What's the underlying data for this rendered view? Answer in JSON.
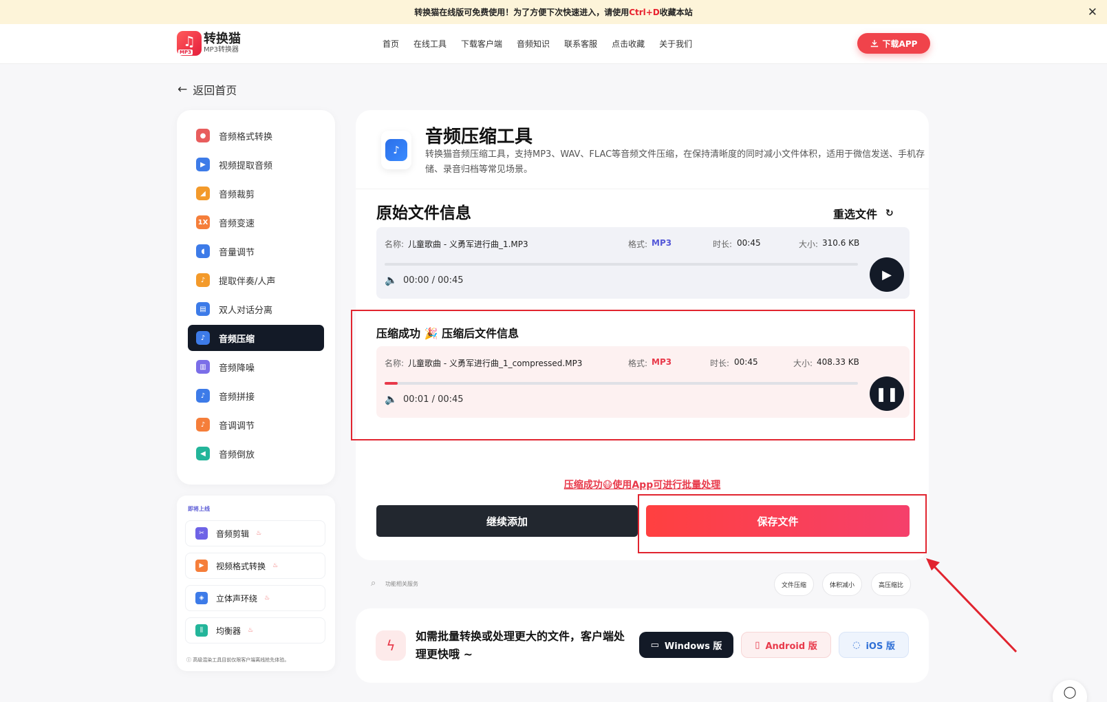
{
  "announcement": {
    "prefix": "转换猫在线版可免费使用！为了方便下次快速进入，请使用",
    "hotkey": "Ctrl+D",
    "suffix": "收藏本站",
    "close": "✕"
  },
  "header": {
    "logo_title": "转换猫",
    "logo_sub": "MP3转换器",
    "logo_badge": "MP3",
    "nav": [
      "首页",
      "在线工具",
      "下载客户端",
      "音频知识",
      "联系客服",
      "点击收藏",
      "关于我们"
    ],
    "download_app": "下载APP"
  },
  "back_label": "返回首页",
  "sidebar": {
    "items": [
      {
        "label": "音频格式转换",
        "icon": "format-convert-icon",
        "color": "#e85d5d"
      },
      {
        "label": "视频提取音频",
        "icon": "video-extract-icon",
        "color": "#3d7be8"
      },
      {
        "label": "音频裁剪",
        "icon": "audio-cut-icon",
        "color": "#f39a2b"
      },
      {
        "label": "音频变速",
        "icon": "speed-icon",
        "color": "#f57e3a"
      },
      {
        "label": "音量调节",
        "icon": "volume-adjust-icon",
        "color": "#3d7be8"
      },
      {
        "label": "提取伴奏/人声",
        "icon": "vocal-extract-icon",
        "color": "#f39a2b"
      },
      {
        "label": "双人对话分离",
        "icon": "dialog-split-icon",
        "color": "#3d7be8"
      },
      {
        "label": "音频压缩",
        "icon": "audio-compress-icon",
        "color": "#3d7be8"
      },
      {
        "label": "音频降噪",
        "icon": "denoise-icon",
        "color": "#7b6ee8"
      },
      {
        "label": "音频拼接",
        "icon": "audio-join-icon",
        "color": "#3d7be8"
      },
      {
        "label": "音调调节",
        "icon": "pitch-icon",
        "color": "#f57e3a"
      },
      {
        "label": "音频倒放",
        "icon": "reverse-icon",
        "color": "#23b59a"
      }
    ],
    "active_index": 7
  },
  "coming_soon": {
    "title": "即将上线",
    "items": [
      {
        "label": "音频剪辑",
        "icon": "audio-edit-icon",
        "color": "#6e63e6"
      },
      {
        "label": "视频格式转换",
        "icon": "video-format-icon",
        "color": "#f57e3a"
      },
      {
        "label": "立体声环绕",
        "icon": "surround-icon",
        "color": "#3d7be8"
      },
      {
        "label": "均衡器",
        "icon": "equalizer-icon",
        "color": "#23b59a"
      }
    ],
    "note": "ⓘ 高级混染工具目前仅限客户端离线抢先体验。"
  },
  "tool": {
    "title": "音频压缩工具",
    "description": "转换猫音频压缩工具，支持MP3、WAV、FLAC等音频文件压缩，在保持清晰度的同时减小文件体积，适用于微信发送、手机存储、录音归档等常见场景。"
  },
  "original": {
    "section_title": "原始文件信息",
    "reselect": "重选文件",
    "name_label": "名称:",
    "name": "儿童歌曲 - 义勇军进行曲_1.MP3",
    "format_label": "格式:",
    "format": "MP3",
    "duration_label": "时长:",
    "duration": "00:45",
    "size_label": "大小:",
    "size": "310.6 KB",
    "time": "00:00 / 00:45",
    "progress": 0
  },
  "compressed": {
    "title": "压缩成功 🎉 压缩后文件信息",
    "name_label": "名称:",
    "name": "儿童歌曲 - 义勇军进行曲_1_compressed.MP3",
    "format_label": "格式:",
    "format": "MP3",
    "duration_label": "时长:",
    "duration": "00:45",
    "size_label": "大小:",
    "size": "408.33 KB",
    "time": "00:01 / 00:45",
    "progress": 0.028
  },
  "actions": {
    "batch_link": "压缩成功😷使用App可进行批量处理",
    "continue": "继续添加",
    "save": "保存文件"
  },
  "related": {
    "label": "功能相关服务",
    "chips": [
      "文件压缩",
      "体积减小",
      "高压缩比"
    ]
  },
  "bottom": {
    "text": "如需批量转换或处理更大的文件，客户端处理更快哦 ~",
    "windows": "Windows 版",
    "android": "Android 版",
    "ios": "iOS 版"
  }
}
